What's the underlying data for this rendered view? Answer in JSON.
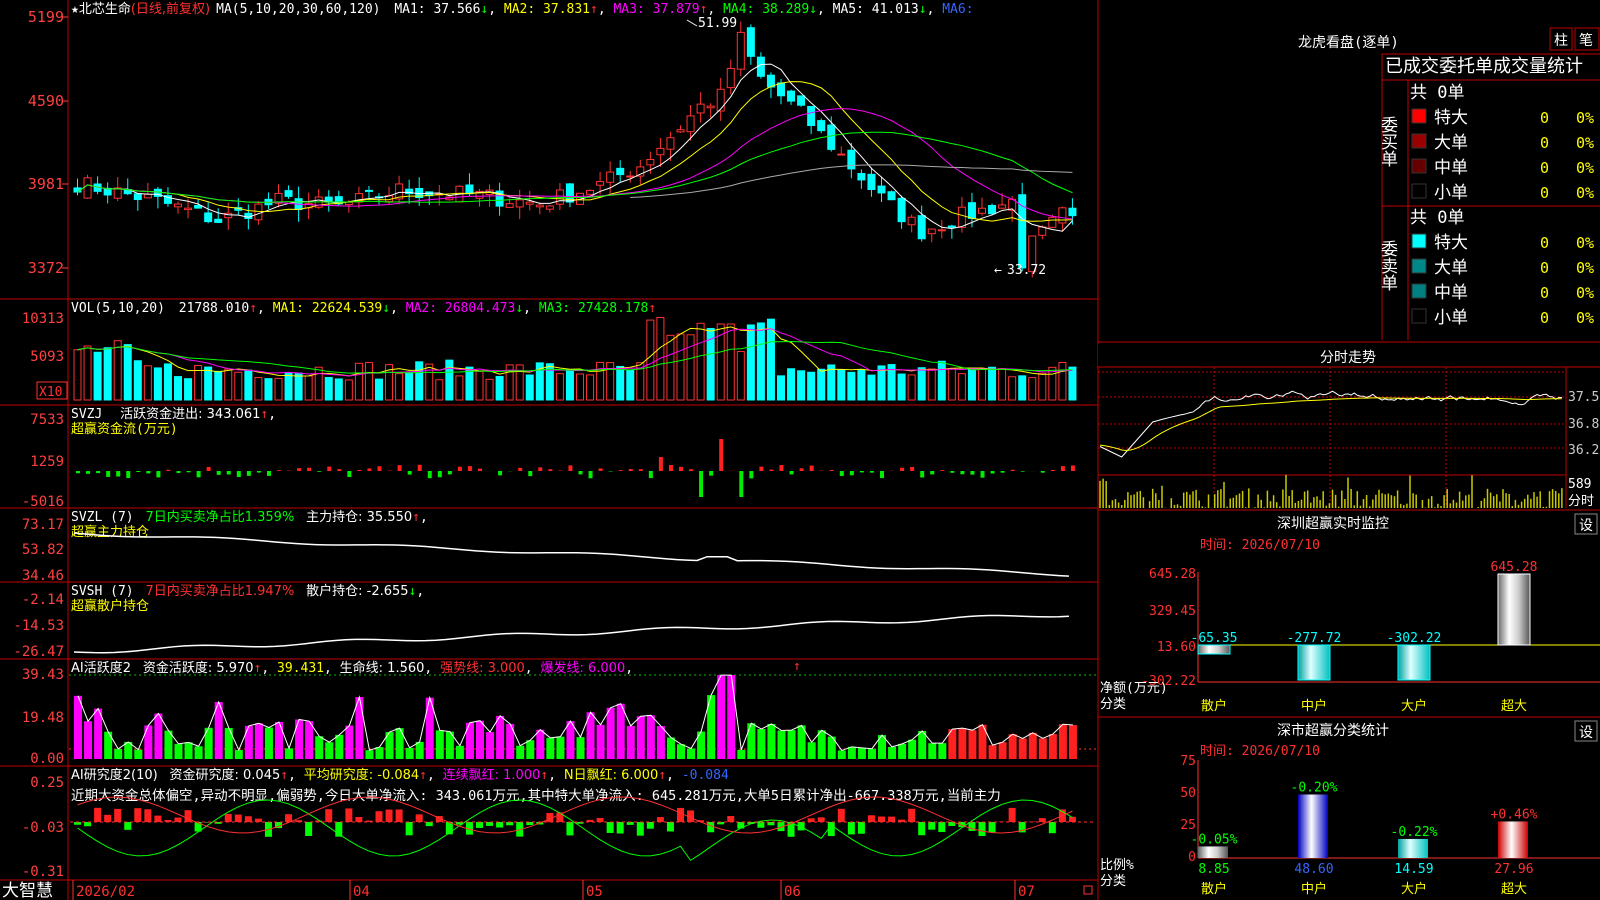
{
  "stock": {
    "name": "北芯生命",
    "mode": "(日线,前复权)",
    "ma_label": "MA(5,10,20,30,60,120)",
    "ma": [
      {
        "label": "MA1: 37.566",
        "arrow": "↓",
        "color": "#ffffff"
      },
      {
        "label": "MA2: 37.831",
        "arrow": "↑",
        "color": "#ffff00"
      },
      {
        "label": "MA3: 37.879",
        "arrow": "↑",
        "color": "#ff00ff"
      },
      {
        "label": "MA4: 38.289",
        "arrow": "↓",
        "color": "#00ff00"
      },
      {
        "label": "MA5: 41.013",
        "arrow": "↓",
        "color": "#ffffff"
      },
      {
        "label": "MA6:",
        "arrow": "",
        "color": "#3366ff"
      }
    ],
    "y_ticks": [
      "5199",
      "4590",
      "3981",
      "3372"
    ],
    "high_label": "51.99",
    "low_label": "33.72"
  },
  "volume": {
    "title": "VOL(5,10,20)",
    "value": "21788.010",
    "value_arrow": "↑",
    "ma1": "MA1: 22624.539",
    "ma1_arrow": "↓",
    "ma2": "MA2: 26804.473",
    "ma2_arrow": "↓",
    "ma3": "MA3: 27428.178",
    "ma3_arrow": "↑",
    "y_ticks": [
      "10313",
      "5093"
    ],
    "unit": "X10"
  },
  "svzj": {
    "title": "SVZJ",
    "label": "活跃资金进出: 343.061",
    "arrow": "↑",
    "sub": "超赢资金流(万元)",
    "y_ticks": [
      "7533",
      "1259",
      "-5016"
    ]
  },
  "svzl": {
    "title": "SVZL (7)",
    "label1": "7日内买卖净占比1.359%",
    "label2": "主力持仓: 35.550",
    "arrow": "↑",
    "sub": "超赢主力持仓",
    "y_ticks": [
      "73.17",
      "53.82",
      "34.46"
    ]
  },
  "svsh": {
    "title": "SVSH (7)",
    "label1": "7日内买卖净占比1.947%",
    "label2": "散户持仓: -2.655",
    "arrow": "↓",
    "sub": "超赢散户持仓",
    "y_ticks": [
      "-2.14",
      "-14.53",
      "-26.47"
    ]
  },
  "ai_active": {
    "title": "AI活跃度2",
    "label1": "资金活跃度: 5.970",
    "v2": "39.431",
    "v3": "生命线: 1.560",
    "v4": "强势线: 3.000",
    "v5": "爆发线: 6.000",
    "y_ticks": [
      "39.43",
      "19.48",
      "0.00"
    ]
  },
  "ai_research": {
    "title": "AI研究度2(10)",
    "label1": "资金研究度: 0.045",
    "label2": "平均研究度: -0.084",
    "label3": "连续飘红: 1.000",
    "label4": "N日飘红: 6.000",
    "label5": "-0.084",
    "summary": "近期大资金总体偏空,异动不明显,偏弱势,今日大单净流入: 343.061万元,其中特大单净流入: 645.281万元,大单5日累计净出-667.338万元,当前主力",
    "y_ticks": [
      "0.25",
      "-0.03",
      "-0.31"
    ]
  },
  "date_axis": {
    "brand": "大智慧",
    "labels": [
      "2026/02",
      "04",
      "05",
      "06",
      "07"
    ]
  },
  "dragon_tiger": {
    "title": "龙虎看盘(逐单)",
    "btn_bar": "柱",
    "btn_line": "笔",
    "header": "已成交委托单成交量统计",
    "buy_title": "委买单",
    "sell_title": "委卖单",
    "buy_total": "共 0单",
    "sell_total": "共 0单",
    "buy_rows": [
      {
        "label": "特大",
        "count": "0",
        "pct": "0%",
        "color": "#ff0000"
      },
      {
        "label": "大单",
        "count": "0",
        "pct": "0%",
        "color": "#990000"
      },
      {
        "label": "中单",
        "count": "0",
        "pct": "0%",
        "color": "#660000"
      },
      {
        "label": "小单",
        "count": "0",
        "pct": "0%",
        "color": "#000000"
      }
    ],
    "sell_rows": [
      {
        "label": "特大",
        "count": "0",
        "pct": "0%",
        "color": "#00ffff"
      },
      {
        "label": "大单",
        "count": "0",
        "pct": "0%",
        "color": "#008888"
      },
      {
        "label": "中单",
        "count": "0",
        "pct": "0%",
        "color": "#008080"
      },
      {
        "label": "小单",
        "count": "0",
        "pct": "0%",
        "color": "#000000"
      }
    ]
  },
  "intraday": {
    "title": "分时走势",
    "price_ticks": [
      "37.51",
      "36.86",
      "36.22"
    ],
    "vol_tick": "589",
    "vol_unit": "分时"
  },
  "sz_monitor": {
    "title": "深圳超赢实时监控",
    "btn": "设",
    "time_label": "时间: 2026/07/10",
    "y_ticks": [
      "645.28",
      "329.45",
      "13.60",
      "-302.22"
    ],
    "ylabel": "净额(万元)",
    "xlabel": "分类",
    "categories": [
      "散户",
      "中户",
      "大户",
      "超大"
    ],
    "values": [
      -65.35,
      -277.72,
      -302.22,
      645.28
    ],
    "value_labels": [
      "-65.35",
      "-277.72",
      "-302.22",
      "645.28"
    ]
  },
  "sz_stats": {
    "title": "深市超赢分类统计",
    "btn": "设",
    "time_label": "时间: 2026/07/10",
    "y_ticks": [
      "75",
      "50",
      "25",
      "0"
    ],
    "ylabel": "比例%",
    "xlabel": "分类",
    "categories": [
      "散户",
      "中户",
      "大户",
      "超大"
    ],
    "values": [
      8.85,
      48.6,
      14.59,
      27.96
    ],
    "value_labels": [
      "8.85",
      "48.60",
      "14.59",
      "27.96"
    ],
    "changes": [
      "-0.05%",
      "-0.20%",
      "-0.22%",
      "+0.46%"
    ]
  },
  "chart_data": [
    {
      "type": "bar",
      "title": "深圳超赢实时监控",
      "xlabel": "分类",
      "ylabel": "净额(万元)",
      "categories": [
        "散户",
        "中户",
        "大户",
        "超大"
      ],
      "values": [
        -65.35,
        -277.72,
        -302.22,
        645.28
      ],
      "ylim": [
        -302.22,
        645.28
      ]
    },
    {
      "type": "bar",
      "title": "深市超赢分类统计",
      "xlabel": "分类",
      "ylabel": "比例%",
      "categories": [
        "散户",
        "中户",
        "大户",
        "超大"
      ],
      "values": [
        8.85,
        48.6,
        14.59,
        27.96
      ],
      "ylim": [
        0,
        75
      ]
    }
  ]
}
